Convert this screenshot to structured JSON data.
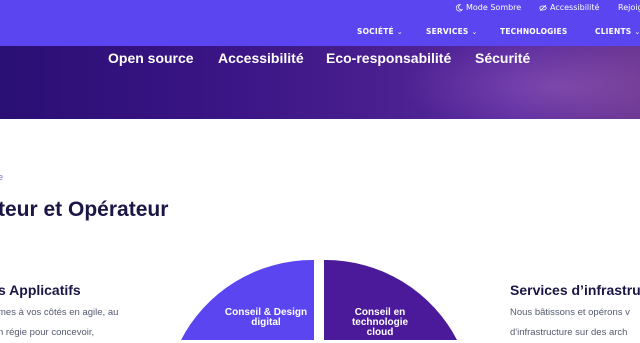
{
  "topbar": {
    "dark_mode": "Mode Sombre",
    "accessibility": "Accessibilité",
    "join": "Rejoig"
  },
  "nav": {
    "items": [
      {
        "label": "SOCIÉTÉ",
        "has_dropdown": true
      },
      {
        "label": "SERVICES",
        "has_dropdown": true
      },
      {
        "label": "TECHNOLOGIES",
        "has_dropdown": false
      },
      {
        "label": "CLIENTS",
        "has_dropdown": true
      }
    ]
  },
  "hero": {
    "tags": [
      "Open source",
      "Accessibilité",
      "Eco-responsabilité",
      "Sécurité"
    ]
  },
  "breadcrumb": "e",
  "page_title": "teur et Opérateur",
  "left_column": {
    "heading": "s Applicatifs",
    "lines": [
      "mes à vos côtés en agile, au",
      "n régie pour concevoir,"
    ]
  },
  "diagram": {
    "segments": [
      {
        "label": "Conseil & Design digital",
        "color": "#5a45f0"
      },
      {
        "label": "Conseil en technologie cloud",
        "color": "#4a1a9a"
      }
    ]
  },
  "right_column": {
    "heading": "Services d’infrastru",
    "lines": [
      "Nous bâtissons et opérons v",
      "d'infrastructure sur des arch"
    ]
  },
  "colors": {
    "brand": "#5a45f0",
    "hero_dark": "#2a0f74",
    "heading": "#1b1646"
  }
}
